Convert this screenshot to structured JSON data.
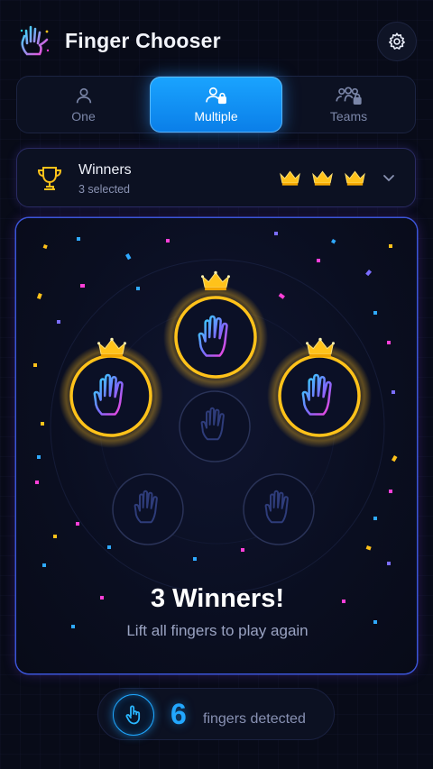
{
  "app": {
    "title": "Finger Chooser"
  },
  "icons": {
    "logo": "neon-hand-icon",
    "settings": "gear-icon",
    "trophy": "trophy-icon",
    "crown": "crown-icon",
    "chevron": "chevron-down-icon",
    "hand": "hand-icon",
    "touch": "pointer-finger-icon"
  },
  "modes": [
    {
      "label": "One",
      "icon": "user-icon",
      "active": false
    },
    {
      "label": "Multiple",
      "icon": "users-lock-icon",
      "active": true
    },
    {
      "label": "Teams",
      "icon": "group-lock-icon",
      "active": false
    }
  ],
  "winners": {
    "title": "Winners",
    "subtitle": "3 selected",
    "crown_count": 3
  },
  "result": {
    "title": "3 Winners!",
    "subtitle": "Lift all fingers to play again"
  },
  "footer": {
    "count": "6",
    "label": "fingers detected"
  },
  "colors": {
    "accent": "#1aa4ff",
    "gold": "#ffc21a",
    "background": "#080b18",
    "neon_pink": "#ff3fd8",
    "neon_cyan": "#29e6ff"
  }
}
